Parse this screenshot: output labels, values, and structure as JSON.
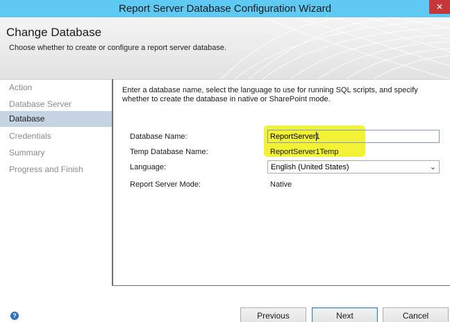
{
  "window": {
    "title": "Report Server Database Configuration Wizard"
  },
  "header": {
    "title": "Change Database",
    "subtitle": "Choose whether to create or configure a report server database."
  },
  "nav": {
    "items": [
      {
        "label": "Action",
        "active": false
      },
      {
        "label": "Database Server",
        "active": false
      },
      {
        "label": "Database",
        "active": true
      },
      {
        "label": "Credentials",
        "active": false
      },
      {
        "label": "Summary",
        "active": false
      },
      {
        "label": "Progress and Finish",
        "active": false
      }
    ]
  },
  "content": {
    "intro": "Enter a database name, select the language to use for running SQL scripts, and specify whether to create the database in native or SharePoint mode.",
    "fields": {
      "database_name_label": "Database Name:",
      "database_name_value": "ReportServer1",
      "temp_database_label": "Temp Database Name:",
      "temp_database_value": "ReportServer1Temp",
      "language_label": "Language:",
      "language_value": "English (United States)",
      "mode_label": "Report Server Mode:",
      "mode_value": "Native"
    }
  },
  "footer": {
    "previous_label": "Previous",
    "next_label": "Next",
    "cancel_label": "Cancel"
  },
  "icons": {
    "help": "help-icon",
    "close": "close-icon",
    "dropdown": "chevron-down-icon"
  },
  "colors": {
    "titlebar": "#5ec9f2",
    "highlight": "#f2f02a",
    "nav_active": "#c6d3e3"
  }
}
